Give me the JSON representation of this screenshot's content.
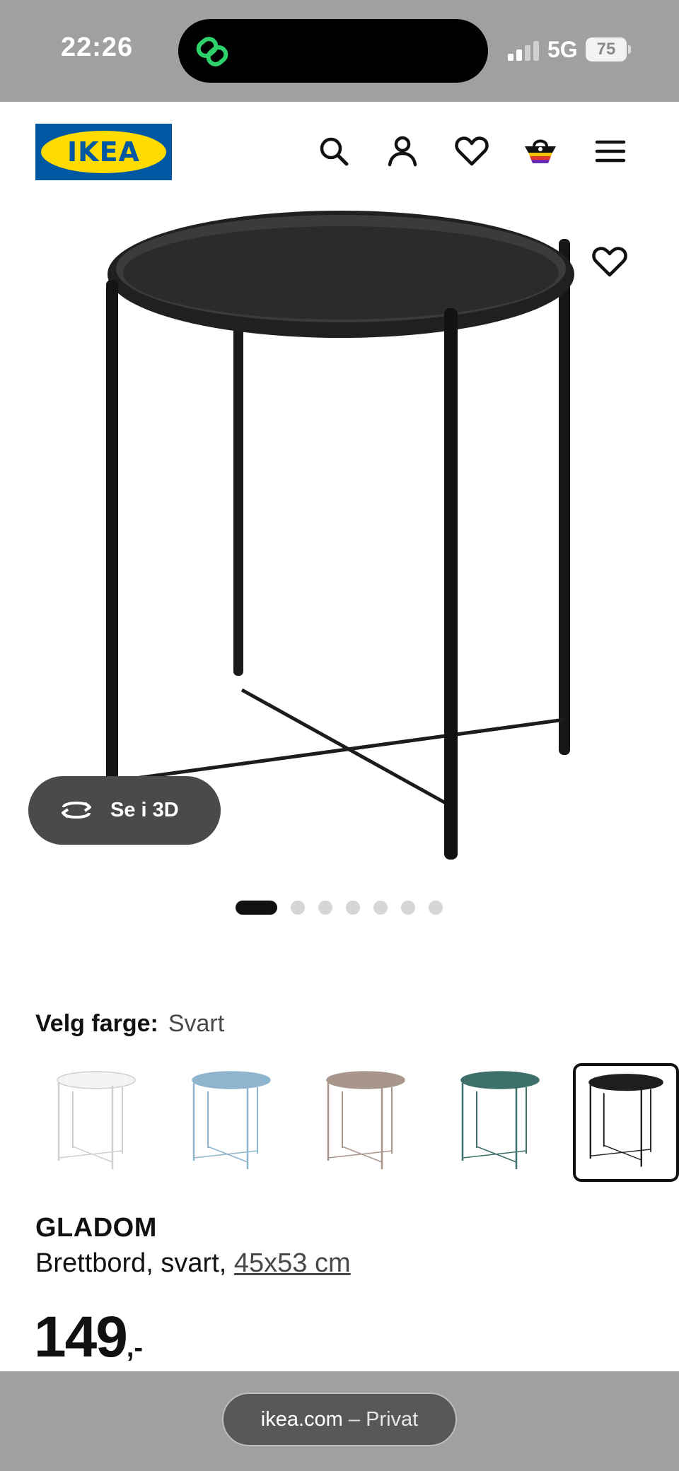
{
  "status_bar": {
    "time": "22:26",
    "network": "5G",
    "battery": "75"
  },
  "header": {
    "logo_text": "IKEA",
    "icons": [
      "search-icon",
      "account-icon",
      "favorites-icon",
      "shopping-bag-icon",
      "menu-icon"
    ]
  },
  "gallery": {
    "see_3d_label": "Se i 3D",
    "image_count": 7,
    "active_index": 0
  },
  "color_picker": {
    "label": "Velg farge:",
    "selected": "Svart",
    "options": [
      "white",
      "light blue",
      "beige",
      "dark green",
      "black"
    ],
    "option_colors": [
      "#f4f4f4",
      "#8fb4cd",
      "#a8958c",
      "#3d6f6b",
      "#1e1e1e"
    ]
  },
  "product": {
    "name": "GLADOM",
    "description": "Brettbord, svart, ",
    "size": "45x53 cm",
    "price": "149",
    "price_suffix": ",-"
  },
  "browser": {
    "url": "ikea.com",
    "mode": " – Privat"
  },
  "colors": {
    "ikea_blue": "#0058a3",
    "ikea_yellow": "#ffdb00",
    "system_gray": "#a0a0a0"
  }
}
